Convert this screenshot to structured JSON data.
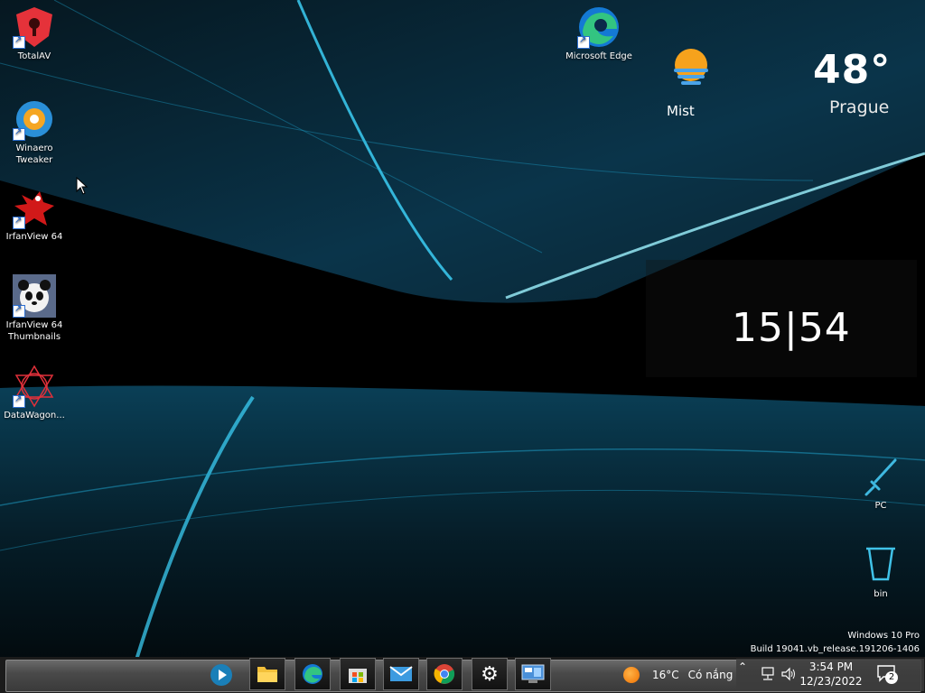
{
  "desktop": {
    "icons": [
      {
        "label": "TotalAV",
        "name": "totalav"
      },
      {
        "label": "Winaero Tweaker",
        "name": "winaero-tweaker"
      },
      {
        "label": "IrfanView 64",
        "name": "irfanview-64"
      },
      {
        "label": "IrfanView 64 Thumbnails",
        "name": "irfanview-64-thumbnails"
      },
      {
        "label": "DataWagon...",
        "name": "datawagon"
      },
      {
        "label": "Microsoft Edge",
        "name": "microsoft-edge"
      },
      {
        "label": "PC",
        "name": "pc"
      },
      {
        "label": "bin",
        "name": "recycle-bin"
      }
    ]
  },
  "weather_widget": {
    "condition": "Mist",
    "temperature": "48°",
    "city": "Prague"
  },
  "clock_widget": {
    "time": "15|54"
  },
  "watermark": {
    "edition": "Windows 10 Pro",
    "build": "Build 19041.vb_release.191206-1406"
  },
  "taskbar": {
    "apps": [
      {
        "name": "media-player-icon"
      },
      {
        "name": "file-explorer-icon"
      },
      {
        "name": "edge-icon"
      },
      {
        "name": "store-icon"
      },
      {
        "name": "mail-icon"
      },
      {
        "name": "chrome-icon"
      },
      {
        "name": "settings-icon"
      },
      {
        "name": "control-panel-icon"
      }
    ],
    "tray": {
      "weather_temp": "16°C",
      "weather_text": "Có nắng",
      "time": "3:54 PM",
      "date": "12/23/2022",
      "notification_count": "2"
    }
  },
  "colors": {
    "accent": "#19c6ff",
    "taskbar": "#3a3a3a"
  }
}
